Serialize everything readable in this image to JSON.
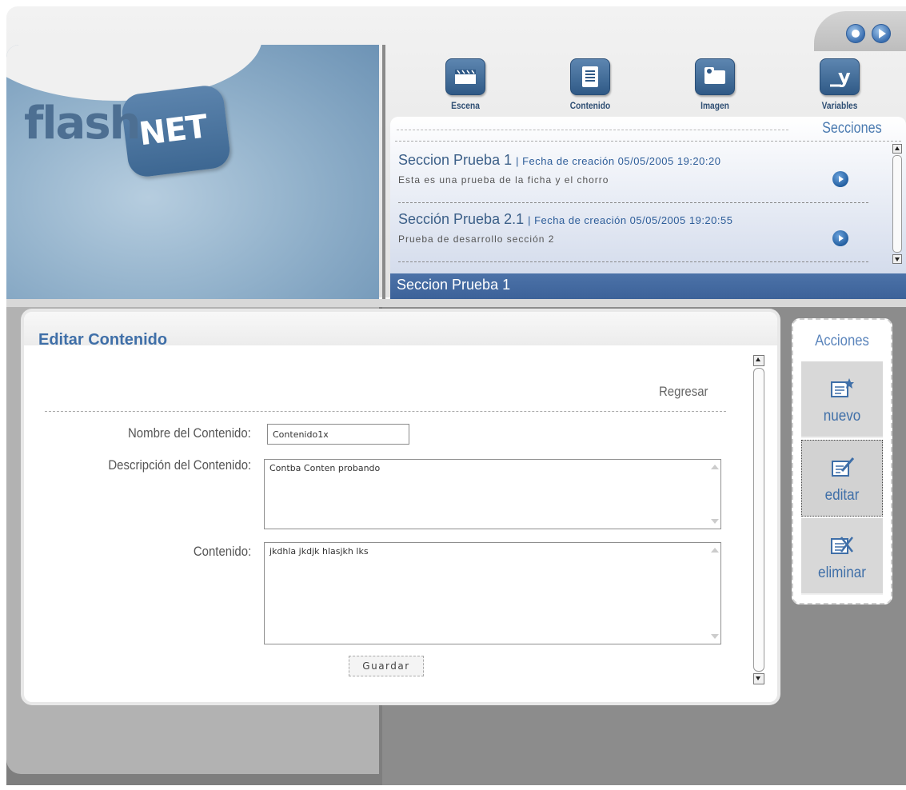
{
  "app": {
    "logo_text": "flash",
    "logo_badge": "NET"
  },
  "window_buttons": [
    {
      "icon": "circle-icon"
    },
    {
      "icon": "play-icon"
    }
  ],
  "toolbar": {
    "items": [
      {
        "label": "Escena",
        "icon": "clapperboard-icon"
      },
      {
        "label": "Contenido",
        "icon": "document-icon"
      },
      {
        "label": "Imagen",
        "icon": "image-icon"
      },
      {
        "label": "Variables",
        "icon": "variable-icon"
      }
    ]
  },
  "secciones": {
    "title": "Secciones",
    "items": [
      {
        "name": "Seccion Prueba 1",
        "date": "| Fecha de creación 05/05/2005 19:20:20",
        "description": "Esta es una prueba de la ficha y el chorro"
      },
      {
        "name": "Sección Prueba 2.1",
        "date": "| Fecha de creación 05/05/2005 19:20:55",
        "description": "Prueba de desarrollo sección 2"
      }
    ],
    "selected": "Seccion Prueba 1"
  },
  "editor": {
    "title": "Editar Contenido",
    "back_link": "Regresar",
    "fields": {
      "nombre_label": "Nombre del Contenido:",
      "nombre_value": "Contenido1x",
      "descripcion_label": "Descripción del Contenido:",
      "descripcion_value": "Contba Conten probando",
      "contenido_label": "Contenido:",
      "contenido_value": "jkdhla jkdjk hlasjkh lks"
    },
    "save_label": "Guardar"
  },
  "acciones": {
    "title": "Acciones",
    "buttons": [
      {
        "label": "nuevo",
        "icon": "new-doc-icon"
      },
      {
        "label": "editar",
        "icon": "edit-icon"
      },
      {
        "label": "eliminar",
        "icon": "delete-icon"
      }
    ]
  },
  "colors": {
    "accent": "#3f6fa8",
    "selected_bar": "#4668a0"
  }
}
